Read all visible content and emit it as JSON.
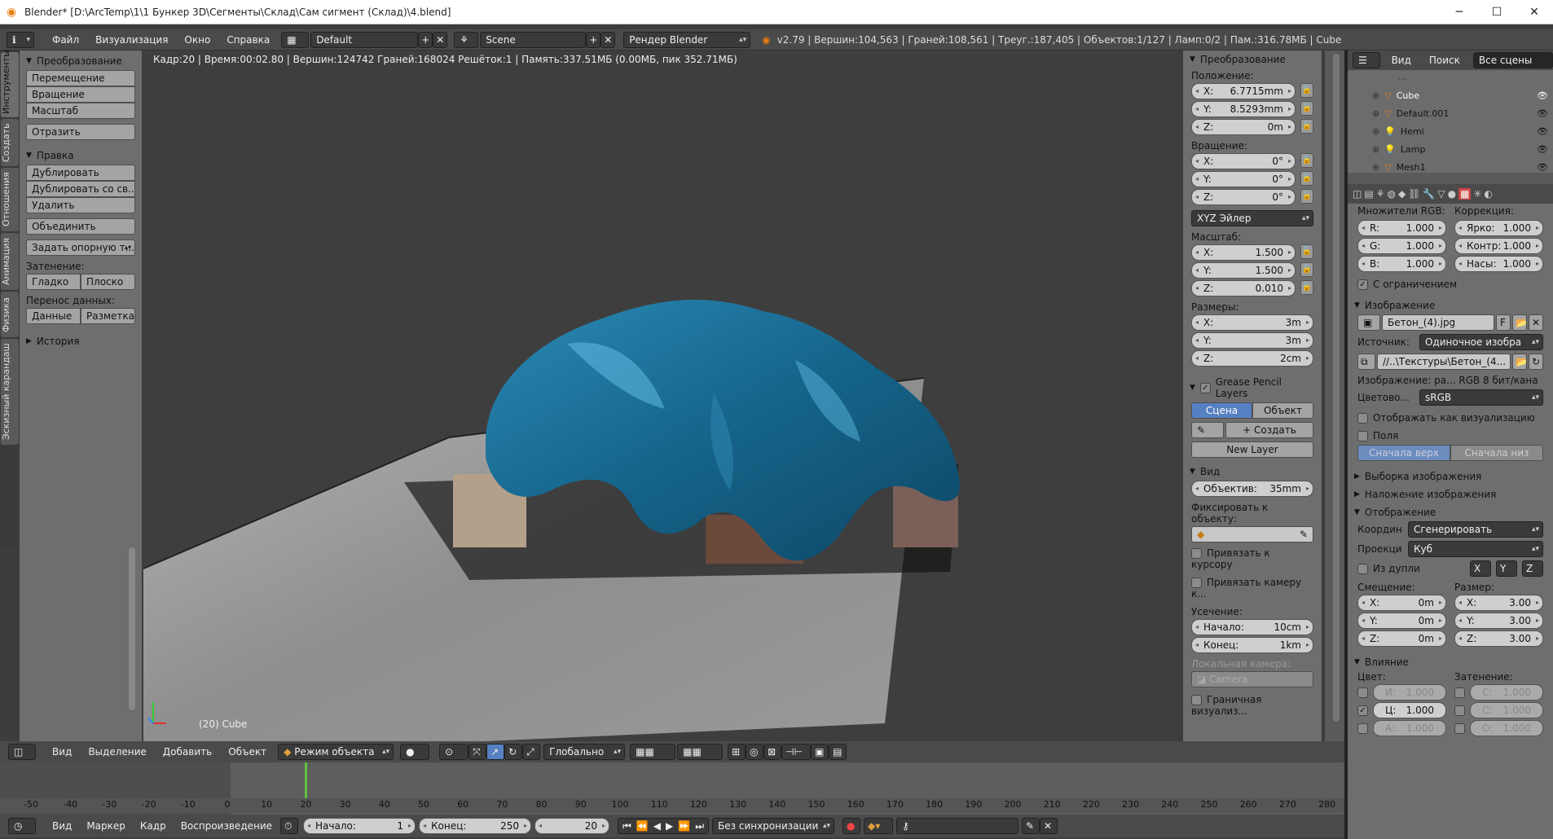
{
  "window": {
    "title": "Blender* [D:\\ArcTemp\\1\\1 Бункер 3D\\Сегменты\\Склад\\Сам сигмент (Склад)\\4.blend]",
    "app_icon": "blender-logo-icon",
    "controls": [
      "minimize-icon",
      "maximize-icon",
      "close-icon"
    ]
  },
  "infobar": {
    "menus": [
      "Файл",
      "Визуализация",
      "Окно",
      "Справка"
    ],
    "layout": "Default",
    "scene": "Scene",
    "engine": "Рендер Blender",
    "stats": "v2.79 | Вершин:104,563 | Граней:108,561 | Треуг.:187,405 | Объектов:1/127 | Ламп:0/2 | Пам.:316.78МБ | Cube"
  },
  "tabs": [
    "Инструменты",
    "Создать",
    "Отношения",
    "Анимация",
    "Физика",
    "Эскизный карандаш"
  ],
  "toolshelf": {
    "transform_header": "Преобразование",
    "transform_buttons": [
      "Перемещение",
      "Вращение",
      "Масштаб"
    ],
    "mirror": "Отразить",
    "edit_header": "Правка",
    "edit_buttons": [
      "Дублировать",
      "Дублировать со св...",
      "Удалить"
    ],
    "join": "Объединить",
    "origin": "Задать опорную т...",
    "shading_label": "Затенение:",
    "smooth": "Гладко",
    "flat": "Плоско",
    "transfer_label": "Перенос данных:",
    "data": "Данные",
    "layout": "Разметка",
    "history": "История"
  },
  "viewport": {
    "info": "Кадр:20 | Время:00:02.80 | Вершин:124742 Граней:168024 Решёток:1 | Память:337.51МБ (0.00МБ, пик 352.71МБ)",
    "object_label": "(20) Cube"
  },
  "npanel": {
    "transform_header": "Преобразование",
    "location_label": "Положение:",
    "location": [
      {
        "axis": "X:",
        "value": "6.7715mm"
      },
      {
        "axis": "Y:",
        "value": "8.5293mm"
      },
      {
        "axis": "Z:",
        "value": "0m"
      }
    ],
    "rotation_label": "Вращение:",
    "rotation": [
      {
        "axis": "X:",
        "value": "0°"
      },
      {
        "axis": "Y:",
        "value": "0°"
      },
      {
        "axis": "Z:",
        "value": "0°"
      }
    ],
    "rotation_mode": "XYZ Эйлер",
    "scale_label": "Масштаб:",
    "scale": [
      {
        "axis": "X:",
        "value": "1.500"
      },
      {
        "axis": "Y:",
        "value": "1.500"
      },
      {
        "axis": "Z:",
        "value": "0.010"
      }
    ],
    "dims_label": "Размеры:",
    "dims": [
      {
        "axis": "X:",
        "value": "3m"
      },
      {
        "axis": "Y:",
        "value": "3m"
      },
      {
        "axis": "Z:",
        "value": "2cm"
      }
    ],
    "gp_header": "Grease Pencil Layers",
    "gp_scene": "Сцена",
    "gp_object": "Объект",
    "gp_create": "Создать",
    "gp_new_layer": "New Layer",
    "view_header": "Вид",
    "lens_label": "Объектив:",
    "lens": "35mm",
    "lock_label": "Фиксировать к объекту:",
    "lock_cursor": "Привязать к курсору",
    "lock_camera": "Привязать камеру к...",
    "clip_label": "Усечение:",
    "clip_start_label": "Начало:",
    "clip_start": "10cm",
    "clip_end_label": "Конец:",
    "clip_end": "1km",
    "local_camera_label": "Локальная камера:",
    "local_camera": "Camera",
    "bounds": "Граничная визуализ..."
  },
  "outliner": {
    "view": "Вид",
    "search": "Поиск",
    "filter": "Все сцены",
    "items": [
      {
        "name": "Cube",
        "icon": "mesh-object-icon",
        "selected": true
      },
      {
        "name": "Default.001",
        "icon": "mesh-object-icon"
      },
      {
        "name": "Hemi",
        "icon": "lamp-icon"
      },
      {
        "name": "Lamp",
        "icon": "lamp-icon"
      },
      {
        "name": "Mesh1",
        "icon": "mesh-object-icon"
      }
    ]
  },
  "props": {
    "rgb_mult_label": "Множители RGB:",
    "correction_label": "Коррекция:",
    "rgb": [
      {
        "axis": "R:",
        "value": "1.000"
      },
      {
        "axis": "G:",
        "value": "1.000"
      },
      {
        "axis": "B:",
        "value": "1.000"
      }
    ],
    "corr": [
      {
        "label": "Ярко:",
        "value": "1.000"
      },
      {
        "label": "Контр:",
        "value": "1.000"
      },
      {
        "label": "Насы:",
        "value": "1.000"
      }
    ],
    "clamp": "С ограничением",
    "image_header": "Изображение",
    "image_name": "Бетон_(4).jpg",
    "image_f": "F",
    "source_label": "Источник:",
    "source": "Одиночное изобра",
    "path": "//..\\Текстуры\\Бетон_(4...",
    "image_info": "Изображение: ра... RGB 8 бит/кана",
    "colorspace_label": "Цветово...",
    "colorspace": "sRGB",
    "view_as_render": "Отображать как визуализацию",
    "fields": "Поля",
    "upper_first": "Сначала верх",
    "lower_first": "Сначала низ",
    "sampling": "Выборка изображения",
    "mapping_img": "Наложение изображения",
    "mapping_header": "Отображение",
    "coords_label": "Координ",
    "coords": "Сгенерировать",
    "projection_label": "Проекци",
    "projection": "Куб",
    "from_dupli": "Из дупли",
    "xyz": [
      "X",
      "Y",
      "Z"
    ],
    "offset_label": "Смещение:",
    "size_label": "Размер:",
    "offset": [
      {
        "axis": "X:",
        "value": "0m"
      },
      {
        "axis": "Y:",
        "value": "0m"
      },
      {
        "axis": "Z:",
        "value": "0m"
      }
    ],
    "size": [
      {
        "axis": "X:",
        "value": "3.00"
      },
      {
        "axis": "Y:",
        "value": "3.00"
      },
      {
        "axis": "Z:",
        "value": "3.00"
      }
    ],
    "influence_header": "Влияние",
    "color_label": "Цвет:",
    "shading_label": "Затенение:",
    "inf_left": [
      {
        "label": "И:",
        "value": "1.000"
      },
      {
        "label": "Ц:",
        "value": "1.000"
      },
      {
        "label": "А:",
        "value": "1.000"
      }
    ],
    "inf_right": [
      {
        "label": "С:",
        "value": "1.000"
      },
      {
        "label": "С:",
        "value": "1.000"
      },
      {
        "label": "О:",
        "value": "1.000"
      }
    ]
  },
  "vpheader": {
    "menus": [
      "Вид",
      "Выделение",
      "Добавить",
      "Объект"
    ],
    "mode": "Режим объекта",
    "orientation": "Глобально"
  },
  "timeline": {
    "ticks": [
      "-50",
      "-40",
      "-30",
      "-20",
      "-10",
      "0",
      "10",
      "20",
      "30",
      "40",
      "50",
      "60",
      "70",
      "80",
      "90",
      "100",
      "110",
      "120",
      "130",
      "140",
      "150",
      "160",
      "170",
      "180",
      "190",
      "200",
      "210",
      "220",
      "230",
      "240",
      "250",
      "260",
      "270",
      "280"
    ],
    "current_frame": 20,
    "menus": [
      "Вид",
      "Маркер",
      "Кадр",
      "Воспроизведение"
    ],
    "start_label": "Начало:",
    "start": "1",
    "end_label": "Конец:",
    "end": "250",
    "frame": "20",
    "sync": "Без синхронизации"
  }
}
